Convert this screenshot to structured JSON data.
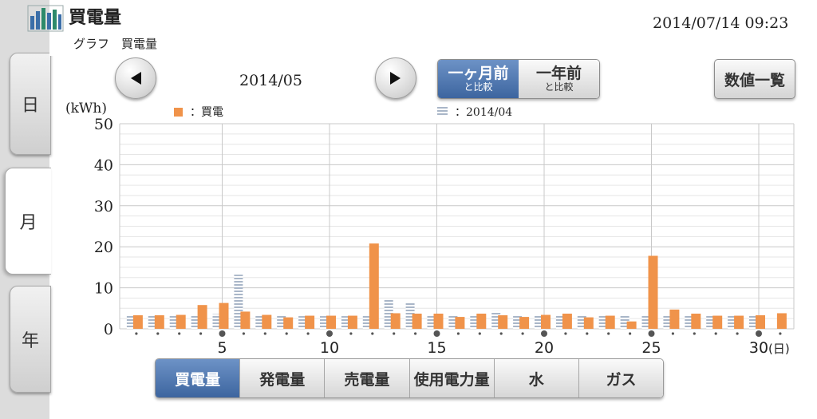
{
  "header": {
    "title": "買電量",
    "subtitle": "グラフ　買電量",
    "datetime": "2014/07/14  09:23"
  },
  "side_tabs": [
    {
      "label": "日",
      "active": false
    },
    {
      "label": "月",
      "active": true
    },
    {
      "label": "年",
      "active": false
    }
  ],
  "nav": {
    "period": "2014/05",
    "prev_icon": "triangle-left-icon",
    "next_icon": "triangle-right-icon"
  },
  "compare": [
    {
      "main": "一ヶ月前",
      "sub": "と比較",
      "active": true
    },
    {
      "main": "一年前",
      "sub": "と比較",
      "active": false
    }
  ],
  "list_button": "数値一覧",
  "legend": {
    "current": "：買電",
    "previous": "：2014/04"
  },
  "colors": {
    "current": "#f0934a",
    "previous": "#a9b6c8",
    "accent": "#4a72ad"
  },
  "bottom_tabs": [
    {
      "label": "買電量",
      "active": true
    },
    {
      "label": "発電量",
      "active": false
    },
    {
      "label": "売電量",
      "active": false
    },
    {
      "label": "使用電力量",
      "active": false
    },
    {
      "label": "水",
      "active": false
    },
    {
      "label": "ガス",
      "active": false
    }
  ],
  "chart_data": {
    "type": "bar",
    "ylabel": "(kWh)",
    "ylim": [
      0,
      50
    ],
    "yticks": [
      0,
      10,
      20,
      30,
      40,
      50
    ],
    "xticks": [
      5,
      10,
      15,
      20,
      25,
      30
    ],
    "xtick_labels": [
      "5",
      "10",
      "15",
      "20",
      "25",
      "30"
    ],
    "x_unit": "(日)",
    "categories": [
      1,
      2,
      3,
      4,
      5,
      6,
      7,
      8,
      9,
      10,
      11,
      12,
      13,
      14,
      15,
      16,
      17,
      18,
      19,
      20,
      21,
      22,
      23,
      24,
      25,
      26,
      27,
      28,
      29,
      30,
      31
    ],
    "weekend_markers": [
      5,
      10,
      15,
      20,
      25,
      30
    ],
    "grid": true,
    "series": [
      {
        "name": "買電",
        "values": [
          3.3,
          3.3,
          3.4,
          5.8,
          6.3,
          4.2,
          3.4,
          2.8,
          3.2,
          3.2,
          3.2,
          20.8,
          3.8,
          3.7,
          3.7,
          2.9,
          3.7,
          3.3,
          2.9,
          3.4,
          3.7,
          2.8,
          3.2,
          1.8,
          17.8,
          4.7,
          3.7,
          3.2,
          3.2,
          3.3,
          3.8
        ]
      },
      {
        "name": "2014/04",
        "values": [
          3.3,
          3.3,
          3.4,
          3.3,
          3.6,
          13.2,
          3.2,
          3.2,
          3.1,
          3.1,
          3.1,
          3.3,
          7.2,
          6.3,
          3.3,
          3.3,
          3.3,
          4.3,
          3.3,
          3.3,
          3.3,
          3.3,
          3.2,
          3.3,
          3.3,
          3.3,
          3.3,
          3.3,
          3.3,
          3.4
        ]
      }
    ]
  }
}
